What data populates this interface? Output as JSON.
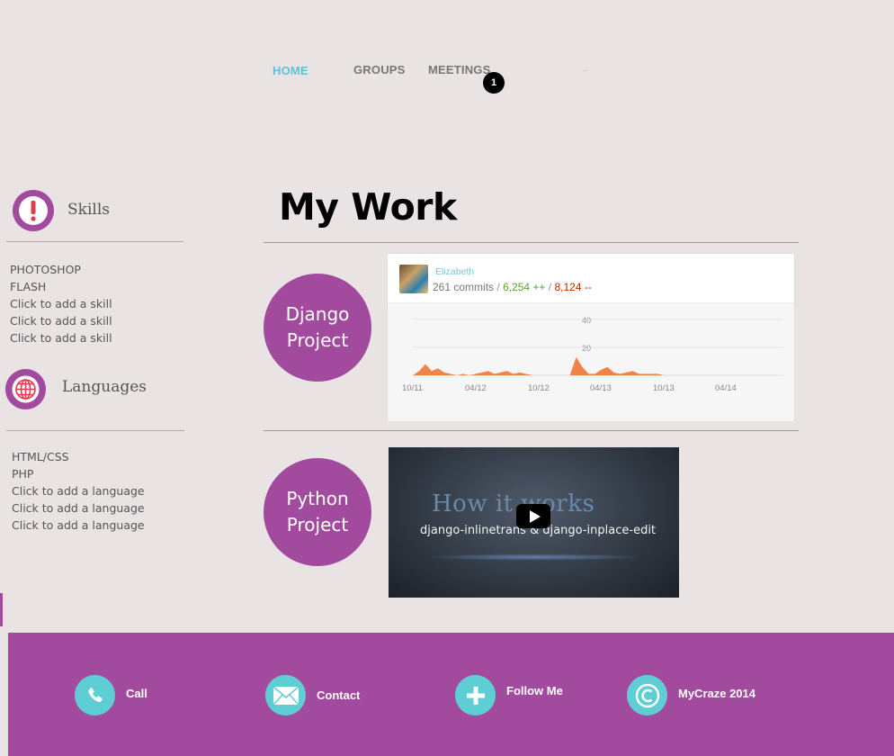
{
  "nav": {
    "items": [
      {
        "label": "HOME"
      },
      {
        "label": "GROUPS"
      },
      {
        "label": "MEETINGS"
      }
    ],
    "badge_count": "1",
    "dots": ".."
  },
  "sidebar": {
    "skills": {
      "heading": "Skills",
      "icon": "exclamation-icon",
      "items": [
        "PHOTOSHOP",
        "FLASH",
        "Click to add a skill",
        "Click to add a skill",
        "Click to add a skill"
      ]
    },
    "languages": {
      "heading": "Languages",
      "icon": "globe-icon",
      "items": [
        "HTML/CSS",
        "PHP",
        "Click to add a language",
        "Click to add a language",
        "Click to add a language"
      ]
    }
  },
  "main": {
    "title": "My Work",
    "projects": [
      {
        "label": "Django Project"
      },
      {
        "label": "Python Project"
      }
    ],
    "commit_card": {
      "user": "Elizabeth",
      "commits": "261 commits",
      "additions": "6,254 ++",
      "deletions": "8,124 --",
      "separator": "/",
      "y_ticks": [
        "40",
        "20"
      ],
      "x_ticks": [
        "10/11",
        "04/12",
        "10/12",
        "04/13",
        "10/13",
        "04/14"
      ]
    },
    "video": {
      "title": "How it works",
      "subtitle": "django-inlinetrans & django-inplace-edit"
    }
  },
  "footer": {
    "items": [
      {
        "label": "Call",
        "icon": "phone-icon"
      },
      {
        "label": "Contact",
        "icon": "envelope-icon"
      },
      {
        "label": "Follow Me",
        "icon": "plus-icon"
      },
      {
        "label": "MyCraze 2014",
        "icon": "copyright-icon"
      }
    ]
  },
  "colors": {
    "background": "#e9e4e3",
    "accent_purple": "#a24a9e",
    "accent_teal": "#5fcdd4",
    "nav_active": "#5cc3d3",
    "chart_fill": "#f0834a"
  },
  "chart_data": {
    "type": "area",
    "title": "",
    "x_ticks": [
      "10/11",
      "04/12",
      "10/12",
      "04/13",
      "10/13",
      "04/14"
    ],
    "y_ticks": [
      40,
      20
    ],
    "ylim": [
      0,
      45
    ],
    "series": [
      {
        "values": [
          0,
          3,
          8,
          3,
          5,
          2,
          1,
          0,
          1,
          0,
          1,
          2,
          3,
          1,
          2,
          3,
          1,
          2,
          1,
          0,
          0,
          0,
          0,
          0,
          0,
          0,
          13,
          6,
          1,
          1,
          4,
          6,
          2,
          1,
          2,
          3,
          1,
          1,
          1,
          1,
          0,
          0,
          0,
          0,
          0,
          0,
          0,
          0,
          0,
          0,
          0,
          0,
          0,
          0,
          0,
          0,
          0,
          0,
          0,
          0
        ]
      }
    ]
  }
}
